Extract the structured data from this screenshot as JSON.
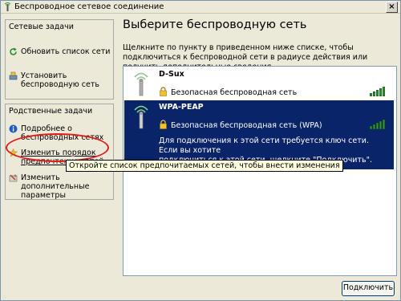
{
  "window": {
    "title": "Беспроводное сетевое соединение",
    "close_label": "×"
  },
  "sidebar": {
    "network_tasks": {
      "title": "Сетевые задачи",
      "items": [
        {
          "label": "Обновить список сети",
          "icon": "refresh-icon"
        },
        {
          "label": "Установить беспроводную сеть",
          "icon": "setup-wizard-icon"
        }
      ]
    },
    "related_tasks": {
      "title": "Родственные задачи",
      "items": [
        {
          "label": "Подробнее о беспроводных сетях",
          "icon": "info-icon"
        },
        {
          "label": "Изменить порядок предпочтения сетей",
          "icon": "star-icon"
        },
        {
          "label": "Изменить дополнительные параметры",
          "icon": "settings-icon"
        }
      ]
    }
  },
  "main": {
    "title": "Выберите беспроводную сеть",
    "description": "Щелкните по пункту в приведенном ниже списке, чтобы подключиться к беспроводной сети в радиусе действия или получить дополнительные сведения.",
    "networks": [
      {
        "name": "D-Sux",
        "security": "Безопасная беспроводная сеть",
        "signal": "5 of 5",
        "selected": false
      },
      {
        "name": "WPA-PEAP",
        "security": "Безопасная беспроводная сеть (WPA)",
        "signal": "5 of 5",
        "selected": true,
        "note": "Для подключения к этой сети требуется ключ сети. Если вы хотите\nподключиться к этой сети, щелкните \"Подключить\"."
      }
    ],
    "connect_button": "Подключить"
  },
  "tooltip": "Откройте список предпочитаемых сетей, чтобы внести изменения",
  "colors": {
    "selection": "#0a246a",
    "highlight_ellipse": "#e01b1b",
    "signal": "#2e9b2e"
  }
}
